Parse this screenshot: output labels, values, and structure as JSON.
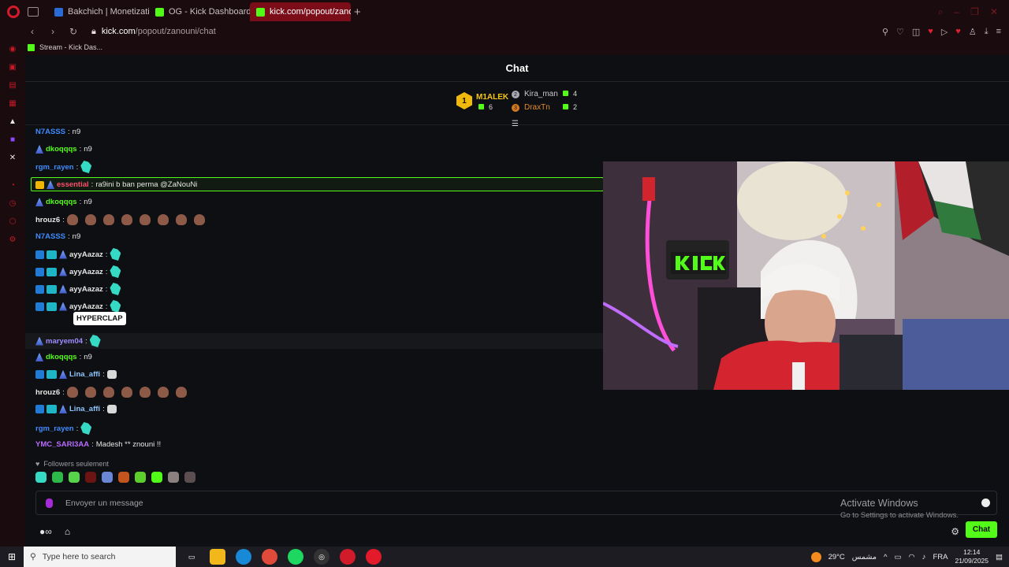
{
  "browser": {
    "tabs": [
      {
        "label": "Bakchich | Monetization n",
        "favicon_color": "#2b6bd6"
      },
      {
        "label": "OG - Kick Dashboard",
        "favicon_color": "#53fc18"
      },
      {
        "label": "kick.com/popout/zanoun",
        "favicon_color": "#53fc18",
        "active": true
      }
    ],
    "new_tab": "+",
    "url_host": "kick.com",
    "url_path": "/popout/zanouni/chat",
    "bookmark": "Stream - Kick Das..."
  },
  "chat": {
    "title": "Chat",
    "leaderboard": {
      "first": {
        "rank": "1",
        "name": "M1ALEK",
        "count": "6"
      },
      "second": {
        "rank": "2",
        "name": "Kira_man",
        "count": "4"
      },
      "third": {
        "rank": "3",
        "name": "DraxTn",
        "count": "2"
      }
    },
    "messages": [
      {
        "user": "N7ASSS",
        "color": "#3f8cff",
        "text": "n9"
      },
      {
        "user": "dkoqqqs",
        "color": "#53fc18",
        "text": "n9"
      },
      {
        "user": "rgm_rayen",
        "color": "#3f8cff",
        "text": ""
      },
      {
        "user": "essential",
        "color": "#ff4d6d",
        "text": "ra9ini b ban perma @ZaNouNi"
      },
      {
        "user": "dkoqqqs",
        "color": "#53fc18",
        "text": "n9"
      },
      {
        "user": "hrouz6",
        "color": "#e7e7e7",
        "text": ""
      },
      {
        "user": "N7ASSS",
        "color": "#3f8cff",
        "text": "n9"
      },
      {
        "user": "ayyAazaz",
        "color": "#e7e7e7",
        "text": ""
      },
      {
        "user": "ayyAazaz",
        "color": "#e7e7e7",
        "text": ""
      },
      {
        "user": "ayyAazaz",
        "color": "#e7e7e7",
        "text": ""
      },
      {
        "user": "ayyAazaz",
        "color": "#e7e7e7",
        "text": ""
      },
      {
        "user": "maryem04",
        "color": "#9e8cff",
        "text": ""
      },
      {
        "user": "dkoqqqs",
        "color": "#53fc18",
        "text": "n9"
      },
      {
        "user": "Lina_affi",
        "color": "#8ec5ff",
        "text": ""
      },
      {
        "user": "hrouz6",
        "color": "#e7e7e7",
        "text": ""
      },
      {
        "user": "Lina_affi",
        "color": "#8ec5ff",
        "text": ""
      },
      {
        "user": "rgm_rayen",
        "color": "#3f8cff",
        "text": ""
      },
      {
        "user": "YMC_SARI3AA",
        "color": "#b96bff",
        "text": "Madesh ** znouni !!"
      }
    ],
    "tooltip": "HYPERCLAP",
    "followers_only": "Followers seulement",
    "input_placeholder": "Envoyer un message",
    "send_button": "Chat"
  },
  "watermark": {
    "title": "Activate Windows",
    "subtitle": "Go to Settings to activate Windows."
  },
  "taskbar": {
    "search_placeholder": "Type here to search",
    "weather": "29°C",
    "weather_desc": "مشمس",
    "language": "FRA",
    "time": "12:14",
    "date": "21/09/2025"
  }
}
